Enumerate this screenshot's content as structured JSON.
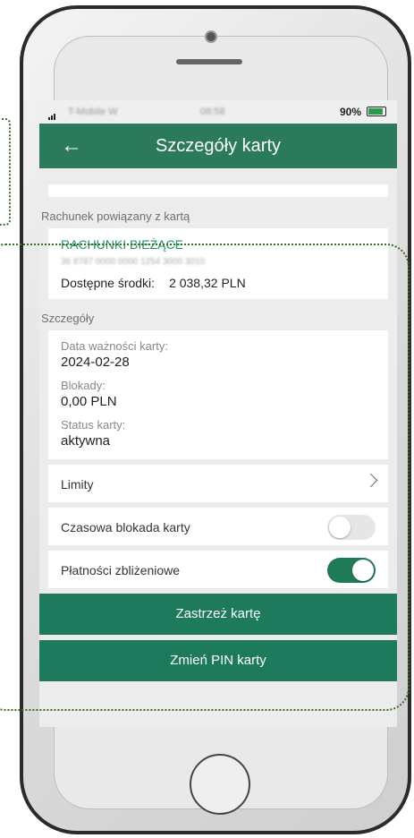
{
  "status_bar": {
    "carrier": "T-Mobile W",
    "time": "08:58",
    "battery": "90%"
  },
  "header": {
    "title": "Szczegóły karty",
    "back_icon": "arrow-left-icon"
  },
  "linked_account": {
    "section_label": "Rachunek powiązany z kartą",
    "name": "RACHUNKI BIEŻĄCE",
    "number": "36 8787 0000 0000 1254 3000 3010",
    "available_label": "Dostępne środki:",
    "available_value": "2 038,32 PLN"
  },
  "details": {
    "section_label": "Szczegóły",
    "expiry_label": "Data ważności karty:",
    "expiry_value": "2024-02-28",
    "blocks_label": "Blokady:",
    "blocks_value": "0,00 PLN",
    "status_label": "Status karty:",
    "status_value": "aktywna"
  },
  "limits": {
    "label": "Limity"
  },
  "temp_block": {
    "label": "Czasowa blokada karty",
    "enabled": false
  },
  "contactless": {
    "label": "Płatności zbliżeniowe",
    "enabled": true
  },
  "actions": {
    "restrict": "Zastrzeż kartę",
    "change_pin": "Zmień PIN karty"
  },
  "colors": {
    "brand": "#2b7a5b",
    "accent": "#1f9470"
  }
}
